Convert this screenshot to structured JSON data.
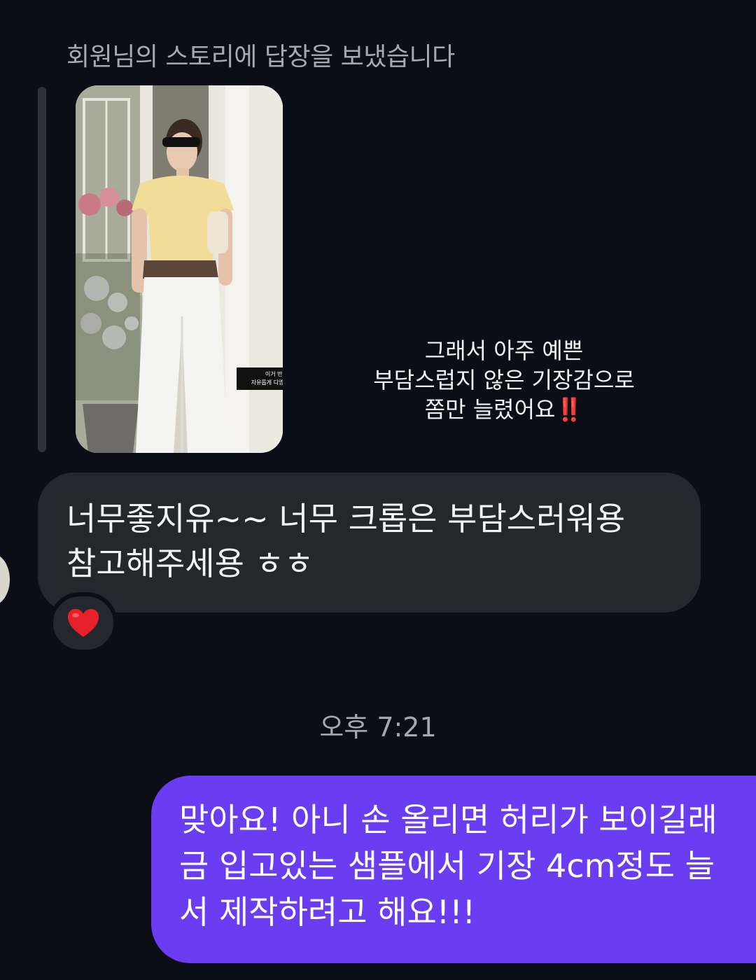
{
  "story_reply": {
    "header": "회원님의 스토리에 답장을 보냈습니다",
    "caption_line1": "이거 반팔티 어때요?",
    "caption_line2": "자유롭게 디엠으로 답장💌🙏❤️",
    "text_line1": "그래서 아주 예쁜",
    "text_line2": "부담스럽지 않은 기장감으로",
    "text_line3": "쫌만 늘렸어요",
    "text_emoji": "‼️"
  },
  "incoming_message": {
    "line1": "너무좋지유~~ 너무 크롭은 부담스러워용",
    "line2": "참고해주세용 ㅎㅎ",
    "reaction": "❤️"
  },
  "timestamp": "오후 7:21",
  "outgoing_message": {
    "line1": "맞아요! 아니 손 올리면 허리가 보이길래",
    "line2": "금 입고있는 샘플에서 기장 4cm정도 늘",
    "line3": "서 제작하려고 해요!!!"
  },
  "colors": {
    "background": "#0c0e17",
    "incoming_bubble": "#25272e",
    "outgoing_bubble": "#6a3df3",
    "muted_text": "#a7a9b2"
  }
}
